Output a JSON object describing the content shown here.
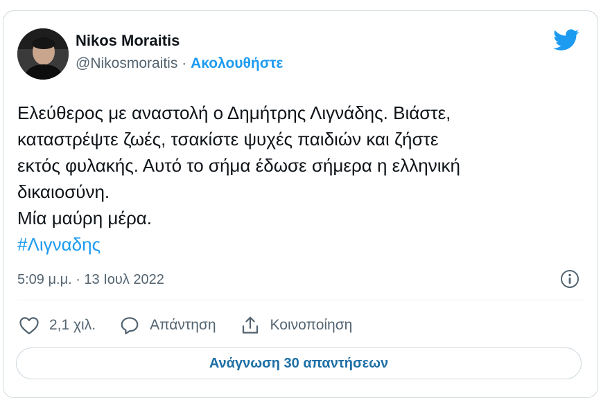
{
  "author": {
    "name": "Nikos Moraitis",
    "handle": "@Nikosmoraitis",
    "separator": "·",
    "follow_label": "Ακολουθήστε"
  },
  "tweet": {
    "lines": [
      "Ελεύθερος με αναστολή ο Δημήτρης Λιγνάδης. Βιάστε,",
      "καταστρέψτε ζωές, τσακίστε ψυχές παιδιών και ζήστε",
      "εκτός φυλακής. Αυτό το σήμα έδωσε σήμερα η ελληνική",
      "δικαιοσύνη.",
      "Μία μαύρη μέρα."
    ],
    "hashtag": "#Λιγναδης",
    "timestamp": "5:09 μ.μ. · 13 Ιουλ 2022"
  },
  "actions": {
    "like_count": "2,1 χιλ.",
    "reply_label": "Απάντηση",
    "share_label": "Κοινοποίηση"
  },
  "read_replies_label": "Ανάγνωση 30 απαντήσεων",
  "icons": {
    "brand": "twitter-bird-icon",
    "info": "info-icon",
    "like": "heart-icon",
    "reply": "speech-bubble-icon",
    "share": "share-upload-icon"
  },
  "colors": {
    "accent": "#1d9bf0",
    "muted": "#536471",
    "text": "#0f1419",
    "border": "#cfd9de"
  }
}
